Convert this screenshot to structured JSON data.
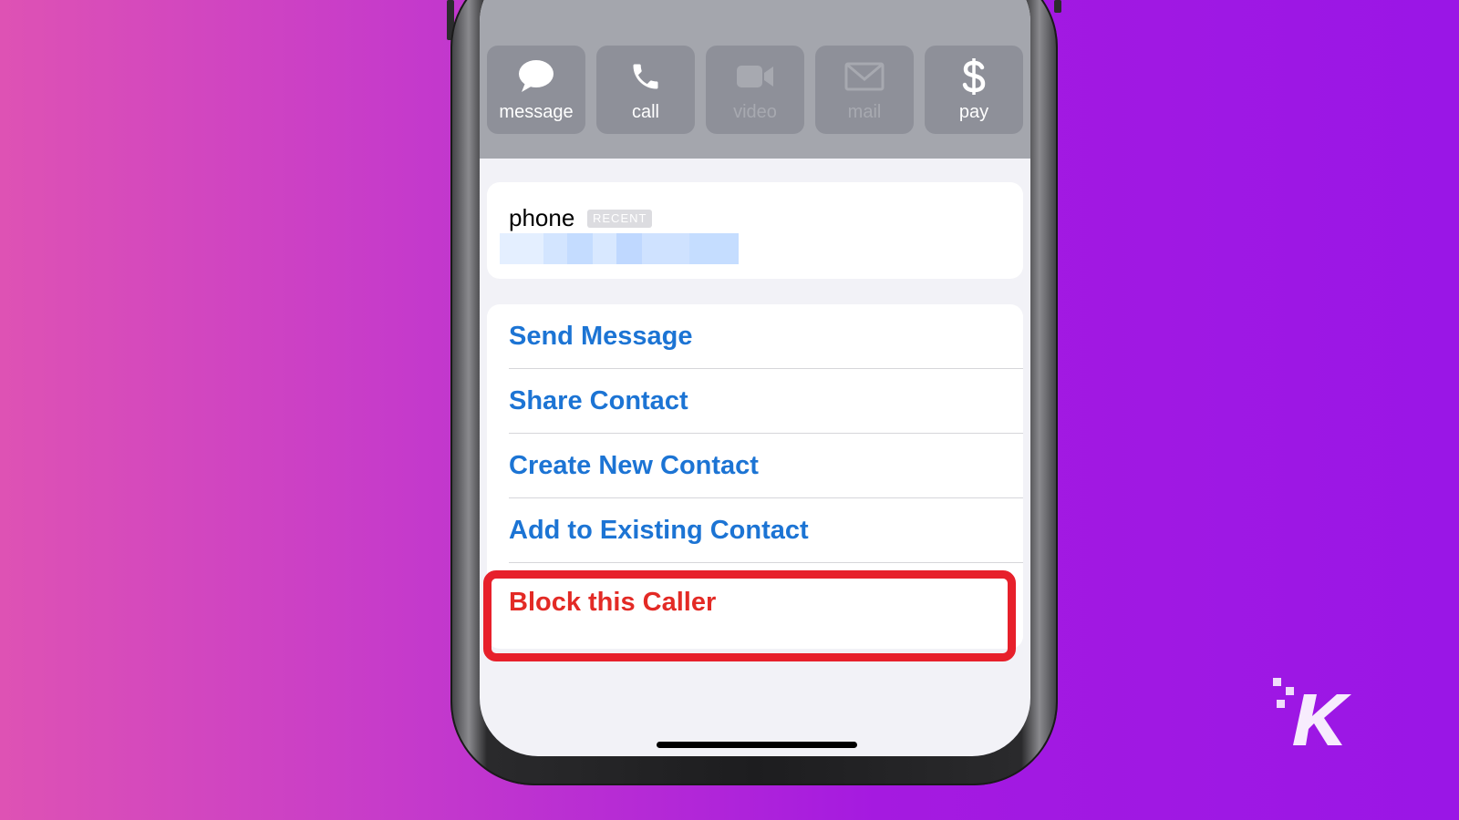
{
  "actions": [
    {
      "label": "message",
      "icon": "speech-bubble-icon",
      "enabled": true
    },
    {
      "label": "call",
      "icon": "phone-icon",
      "enabled": true
    },
    {
      "label": "video",
      "icon": "video-camera-icon",
      "enabled": false
    },
    {
      "label": "mail",
      "icon": "envelope-icon",
      "enabled": false
    },
    {
      "label": "pay",
      "icon": "dollar-icon",
      "enabled": true
    }
  ],
  "phone_card": {
    "label": "phone",
    "badge": "RECENT"
  },
  "menu": {
    "send_message": "Send Message",
    "share_contact": "Share Contact",
    "create_new_contact": "Create New Contact",
    "add_to_existing_contact": "Add to Existing Contact",
    "block_caller": "Block this Caller"
  },
  "colors": {
    "link_blue": "#1c74d4",
    "destructive_red": "#e32a25",
    "highlight_red": "#e7202b",
    "action_bg": "#8e9099",
    "header_bg": "#a4a6ad",
    "background_gradient_start": "#de52b4",
    "background_gradient_end": "#9a16e6"
  }
}
